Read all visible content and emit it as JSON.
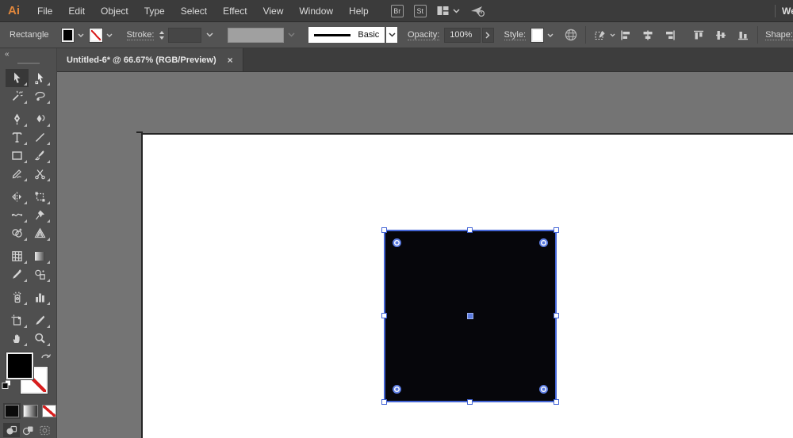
{
  "menubar": {
    "logo": "Ai",
    "items": [
      "File",
      "Edit",
      "Object",
      "Type",
      "Select",
      "Effect",
      "View",
      "Window",
      "Help"
    ],
    "bridge_button": "Br",
    "stock_button": "St",
    "workspace_clipped": "We"
  },
  "controlbar": {
    "selection_label": "Rectangle",
    "stroke_label": "Stroke:",
    "brush_value": "Basic",
    "opacity_label": "Opacity:",
    "opacity_value": "100%",
    "style_label": "Style:",
    "shape_label": "Shape:"
  },
  "tabbar": {
    "tab_title": "Untitled-6* @ 66.67% (RGB/Preview)",
    "close_label": "×"
  },
  "toolbar": {
    "collapse_label": "«",
    "tools": [
      "selection-tool",
      "direct-selection-tool",
      "magic-wand-tool",
      "lasso-tool",
      "pen-tool",
      "curvature-tool",
      "type-tool",
      "line-segment-tool",
      "rectangle-tool",
      "paintbrush-tool",
      "shaper-tool",
      "scissors-tool",
      "reflect-tool",
      "free-transform-tool",
      "width-tool",
      "puppet-warp-tool",
      "shape-builder-tool",
      "perspective-grid-tool",
      "mesh-tool",
      "gradient-tool",
      "eyedropper-tool",
      "blend-tool",
      "symbol-sprayer-tool",
      "column-graph-tool",
      "artboard-tool",
      "slice-tool",
      "hand-tool",
      "zoom-tool"
    ],
    "active_tool": "selection-tool",
    "fill_color": "#000000",
    "stroke_color": "none",
    "drawing_mode": "draw-normal"
  },
  "canvas": {
    "zoom": "66.67%",
    "color_mode": "RGB/Preview",
    "selected_object": {
      "type": "rectangle",
      "fill": "#06060b",
      "stroke": "none"
    }
  },
  "colors": {
    "selection_blue": "#4465d6",
    "logo_orange": "#e0873c",
    "none_red": "#d81e1e",
    "canvas_gray": "#747474",
    "artboard_white": "#ffffff"
  }
}
